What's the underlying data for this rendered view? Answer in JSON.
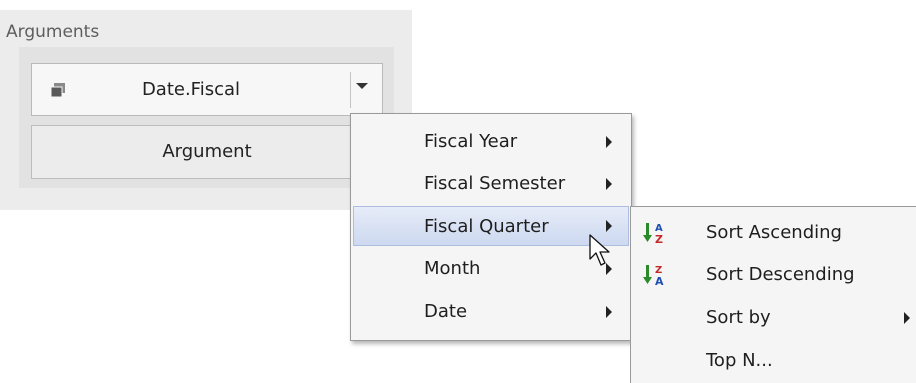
{
  "arguments_panel": {
    "title": "Arguments",
    "field": {
      "label": "Date.Fiscal",
      "icon": "dimension-icon",
      "dropdown_icon": "chevron-down-icon"
    },
    "placeholder_button": "Argument"
  },
  "group_menu": {
    "items": [
      {
        "label": "Fiscal Year",
        "has_submenu": true,
        "highlighted": false
      },
      {
        "label": "Fiscal Semester",
        "has_submenu": true,
        "highlighted": false
      },
      {
        "label": "Fiscal Quarter",
        "has_submenu": true,
        "highlighted": true
      },
      {
        "label": "Month",
        "has_submenu": true,
        "highlighted": false
      },
      {
        "label": "Date",
        "has_submenu": true,
        "highlighted": false
      }
    ]
  },
  "sort_menu": {
    "items": [
      {
        "label": "Sort Ascending",
        "icon": "sort-ascending-icon",
        "has_submenu": false
      },
      {
        "label": "Sort Descending",
        "icon": "sort-descending-icon",
        "has_submenu": false
      },
      {
        "label": "Sort by",
        "icon": "",
        "has_submenu": true
      },
      {
        "label": "Top N...",
        "icon": "",
        "has_submenu": false
      }
    ]
  },
  "colors": {
    "panel_bg": "#ececec",
    "menu_bg": "#f5f5f5",
    "highlight": "#cdd9f0",
    "sort_arrow_green": "#2a8a2a",
    "sort_letter_red": "#c62828",
    "sort_letter_blue": "#1f4fb0"
  }
}
